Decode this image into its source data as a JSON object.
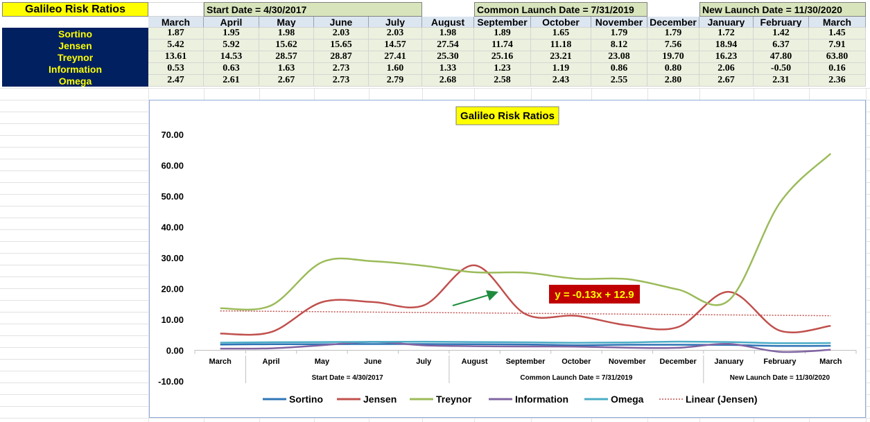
{
  "sheet": {
    "title": "Galileo Risk Ratios",
    "bands": [
      {
        "text": "Start Date = 4/30/2017",
        "from": 1,
        "to": 4
      },
      {
        "text": "Common Launch Date = 7/31/2019",
        "from": 6,
        "to": 8
      },
      {
        "text": "New Launch Date = 11/30/2020",
        "from": 10,
        "to": 12
      }
    ],
    "months": [
      "March",
      "April",
      "May",
      "June",
      "July",
      "August",
      "September",
      "October",
      "November",
      "December",
      "January",
      "February",
      "March"
    ],
    "rows": [
      {
        "label": "Sortino",
        "values": [
          "1.87",
          "1.95",
          "1.98",
          "2.03",
          "2.03",
          "1.98",
          "1.89",
          "1.65",
          "1.79",
          "1.79",
          "1.72",
          "1.42",
          "1.45"
        ]
      },
      {
        "label": "Jensen",
        "values": [
          "5.42",
          "5.92",
          "15.62",
          "15.65",
          "14.57",
          "27.54",
          "11.74",
          "11.18",
          "8.12",
          "7.56",
          "18.94",
          "6.37",
          "7.91"
        ]
      },
      {
        "label": "Treynor",
        "values": [
          "13.61",
          "14.53",
          "28.57",
          "28.87",
          "27.41",
          "25.30",
          "25.16",
          "23.21",
          "23.08",
          "19.70",
          "16.23",
          "47.80",
          "63.80"
        ]
      },
      {
        "label": "Information",
        "values": [
          "0.53",
          "0.63",
          "1.63",
          "2.73",
          "1.60",
          "1.33",
          "1.23",
          "1.19",
          "0.86",
          "0.80",
          "2.06",
          "-0.50",
          "0.16"
        ]
      },
      {
        "label": "Omega",
        "values": [
          "2.47",
          "2.61",
          "2.67",
          "2.73",
          "2.79",
          "2.68",
          "2.58",
          "2.43",
          "2.55",
          "2.80",
          "2.67",
          "2.31",
          "2.36"
        ]
      }
    ]
  },
  "chart_data": {
    "type": "line",
    "title": "Galileo Risk Ratios",
    "categories": [
      "March",
      "April",
      "May",
      "June",
      "July",
      "August",
      "September",
      "October",
      "November",
      "December",
      "January",
      "February",
      "March"
    ],
    "category_groups": [
      {
        "label": "Start Date = 4/30/2017",
        "from": 1,
        "to": 4
      },
      {
        "label": "Common Launch Date = 7/31/2019",
        "from": 5,
        "to": 9
      },
      {
        "label": "New Launch Date = 11/30/2020",
        "from": 10,
        "to": 12
      }
    ],
    "ylim": [
      -10,
      70
    ],
    "yticks": [
      -10,
      0,
      10,
      20,
      30,
      40,
      50,
      60,
      70
    ],
    "ytick_labels": [
      "-10.00",
      "0.00",
      "10.00",
      "20.00",
      "30.00",
      "40.00",
      "50.00",
      "60.00",
      "70.00"
    ],
    "series": [
      {
        "name": "Sortino",
        "color": "#2e75b6",
        "values": [
          1.87,
          1.95,
          1.98,
          2.03,
          2.03,
          1.98,
          1.89,
          1.65,
          1.79,
          1.79,
          1.72,
          1.42,
          1.45
        ]
      },
      {
        "name": "Jensen",
        "color": "#c0504d",
        "values": [
          5.42,
          5.92,
          15.62,
          15.65,
          14.57,
          27.54,
          11.74,
          11.18,
          8.12,
          7.56,
          18.94,
          6.37,
          7.91
        ]
      },
      {
        "name": "Treynor",
        "color": "#9bbb59",
        "values": [
          13.61,
          14.53,
          28.57,
          28.87,
          27.41,
          25.3,
          25.16,
          23.21,
          23.08,
          19.7,
          16.23,
          47.8,
          63.8
        ]
      },
      {
        "name": "Information",
        "color": "#8064a2",
        "values": [
          0.53,
          0.63,
          1.63,
          2.73,
          1.6,
          1.33,
          1.23,
          1.19,
          0.86,
          0.8,
          2.06,
          -0.5,
          0.16
        ]
      },
      {
        "name": "Omega",
        "color": "#4bacc6",
        "values": [
          2.47,
          2.61,
          2.67,
          2.73,
          2.79,
          2.68,
          2.58,
          2.43,
          2.55,
          2.8,
          2.67,
          2.31,
          2.36
        ]
      }
    ],
    "trendline": {
      "name": "Linear (Jensen)",
      "color": "#c0504d",
      "slope": -0.13,
      "intercept": 12.9
    },
    "annotation": {
      "text": "y = -0.13x + 12.9",
      "bg": "#c00000",
      "color": "#ffff00"
    },
    "legend": "bottom",
    "grid": false
  }
}
